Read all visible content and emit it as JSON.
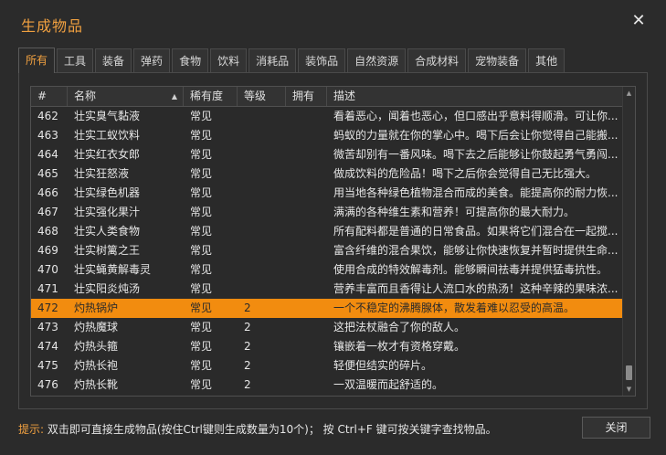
{
  "window": {
    "title": "生成物品",
    "close_icon": "close-icon"
  },
  "tabs": [
    {
      "label": "所有",
      "active": true
    },
    {
      "label": "工具"
    },
    {
      "label": "装备"
    },
    {
      "label": "弹药"
    },
    {
      "label": "食物"
    },
    {
      "label": "饮料"
    },
    {
      "label": "消耗品"
    },
    {
      "label": "装饰品"
    },
    {
      "label": "自然资源"
    },
    {
      "label": "合成材料"
    },
    {
      "label": "宠物装备"
    },
    {
      "label": "其他"
    }
  ],
  "table": {
    "headers": {
      "id": "#",
      "name": "名称",
      "rarity": "稀有度",
      "level": "等级",
      "owned": "拥有",
      "desc": "描述"
    },
    "sort_indicator": "▲",
    "rows": [
      {
        "id": "462",
        "name": "壮实臭气黏液",
        "rarity": "常见",
        "level": "",
        "owned": "",
        "desc": "看着恶心，闻着也恶心，但口感出乎意料得顺滑。可让你..."
      },
      {
        "id": "463",
        "name": "壮实工蚁饮料",
        "rarity": "常见",
        "level": "",
        "owned": "",
        "desc": "蚂蚁的力量就在你的掌心中。喝下后会让你觉得自己能搬..."
      },
      {
        "id": "464",
        "name": "壮实红衣女郎",
        "rarity": "常见",
        "level": "",
        "owned": "",
        "desc": "微苦却别有一番风味。喝下去之后能够让你鼓起勇气勇闯..."
      },
      {
        "id": "465",
        "name": "壮实狂怒液",
        "rarity": "常见",
        "level": "",
        "owned": "",
        "desc": "做成饮料的危险品！喝下之后你会觉得自己无比强大。"
      },
      {
        "id": "466",
        "name": "壮实绿色机器",
        "rarity": "常见",
        "level": "",
        "owned": "",
        "desc": "用当地各种绿色植物混合而成的美食。能提高你的耐力恢..."
      },
      {
        "id": "467",
        "name": "壮实强化果汁",
        "rarity": "常见",
        "level": "",
        "owned": "",
        "desc": "满满的各种维生素和营养！可提高你的最大耐力。"
      },
      {
        "id": "468",
        "name": "壮实人类食物",
        "rarity": "常见",
        "level": "",
        "owned": "",
        "desc": "所有配料都是普通的日常食品。如果将它们混合在一起搅..."
      },
      {
        "id": "469",
        "name": "壮实树篱之王",
        "rarity": "常见",
        "level": "",
        "owned": "",
        "desc": "富含纤维的混合果饮，能够让你快速恢复并暂时提供生命..."
      },
      {
        "id": "470",
        "name": "壮实蝇黄解毒灵",
        "rarity": "常见",
        "level": "",
        "owned": "",
        "desc": "使用合成的特效解毒剂。能够瞬间祛毒并提供猛毒抗性。"
      },
      {
        "id": "471",
        "name": "壮实阳炎炖汤",
        "rarity": "常见",
        "level": "",
        "owned": "",
        "desc": "营养丰富而且香得让人流口水的热汤！这种辛辣的果味浓..."
      },
      {
        "id": "472",
        "name": "灼热锅炉",
        "rarity": "常见",
        "level": "2",
        "owned": "",
        "desc": "一个不稳定的沸腾腺体，散发着难以忍受的高温。",
        "selected": true
      },
      {
        "id": "473",
        "name": "灼热魔球",
        "rarity": "常见",
        "level": "2",
        "owned": "",
        "desc": "这把法杖融合了你的敌人。"
      },
      {
        "id": "474",
        "name": "灼热头箍",
        "rarity": "常见",
        "level": "2",
        "owned": "",
        "desc": "镶嵌着一枚才有资格穿戴。"
      },
      {
        "id": "475",
        "name": "灼热长袍",
        "rarity": "常见",
        "level": "2",
        "owned": "",
        "desc": "轻便但结实的碎片。"
      },
      {
        "id": "476",
        "name": "灼热长靴",
        "rarity": "常见",
        "level": "2",
        "owned": "",
        "desc": "一双温暖而起舒适的。"
      }
    ]
  },
  "footer": {
    "hint_label": "提示:",
    "hint_text": " 双击即可直接生成物品(按住Ctrl键则生成数量为10个)； 按 Ctrl+F 键可按关键字查找物品。",
    "close_button": "关闭"
  },
  "colors": {
    "accent": "#f0a040",
    "selected_row": "#f28c0f",
    "background": "#2b2b2b"
  }
}
